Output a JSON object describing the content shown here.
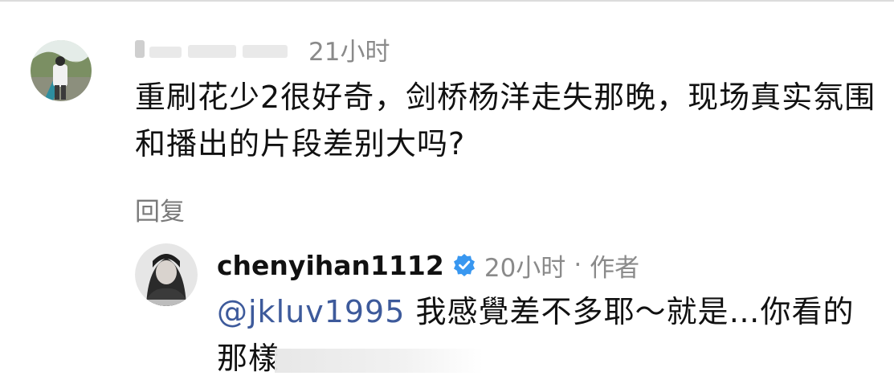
{
  "comment": {
    "username": "",
    "time": "21小时",
    "text": "重刷花少2很好奇，剑桥杨洋走失那晚，现场真实氛围和播出的片段差别大吗?",
    "reply_label": "回复"
  },
  "reply": {
    "username": "chenyihan1112",
    "time": "20小时",
    "separator": "·",
    "role": "作者",
    "mention": "@jkluv1995",
    "text": "我感覺差不多耶～就是…你看的那樣",
    "verified_color": "#3897f0"
  },
  "icons": {
    "commenter_avatar": "avatar-photo",
    "author_avatar": "avatar-photo",
    "verified": "verified-badge-icon"
  }
}
